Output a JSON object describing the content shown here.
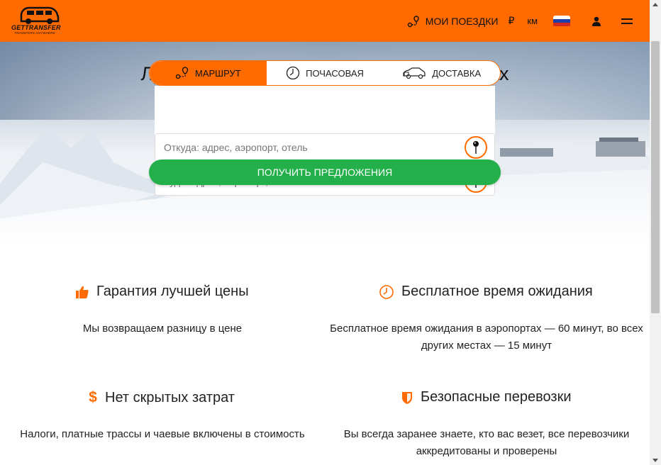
{
  "colors": {
    "brand": "#ff6b00",
    "cta": "#23b04a"
  },
  "header": {
    "logo_text": "GETTRANSFER",
    "logo_tagline": "TRANSFERS ANYWHERE",
    "trips_label": "МОИ ПОЕЗДКИ",
    "currency": "₽",
    "units": "км",
    "language_flag": "russia-flag-icon",
    "user_icon": "user-icon",
    "menu_icon": "hamburger-menu-icon"
  },
  "hero": {
    "title": "Лучшие цены на поездки во всех странах",
    "tabs": [
      {
        "label": "МАРШРУТ",
        "icon": "route-icon",
        "active": true
      },
      {
        "label": "ПОЧАСОВАЯ",
        "icon": "clock-icon",
        "active": false
      },
      {
        "label": "ДОСТАВКА",
        "icon": "delivery-car-icon",
        "active": false
      }
    ],
    "from_placeholder": "Откуда: адрес, аэропорт, отель",
    "to_placeholder": "Куда: адрес, аэропорт, отель",
    "cta_label": "ПОЛУЧИТЬ ПРЕДЛОЖЕНИЯ"
  },
  "features": [
    {
      "title": "Гарантия лучшей цены",
      "icon": "thumbs-up-icon",
      "text": "Мы возвращаем разницу в цене"
    },
    {
      "title": "Бесплатное время ожидания",
      "icon": "clock-icon",
      "text": "Бесплатное время ожидания в аэропортах — 60 минут, во всех других местах — 15 минут"
    },
    {
      "title": "Нет скрытых затрат",
      "icon": "dollar-icon",
      "text": "Налоги, платные трассы и чаевые включены в стоимость"
    },
    {
      "title": "Безопасные перевозки",
      "icon": "shield-icon",
      "text": "Вы всегда заранее знаете, кто вас везет, все перевозчики аккредитованы и проверены"
    }
  ]
}
